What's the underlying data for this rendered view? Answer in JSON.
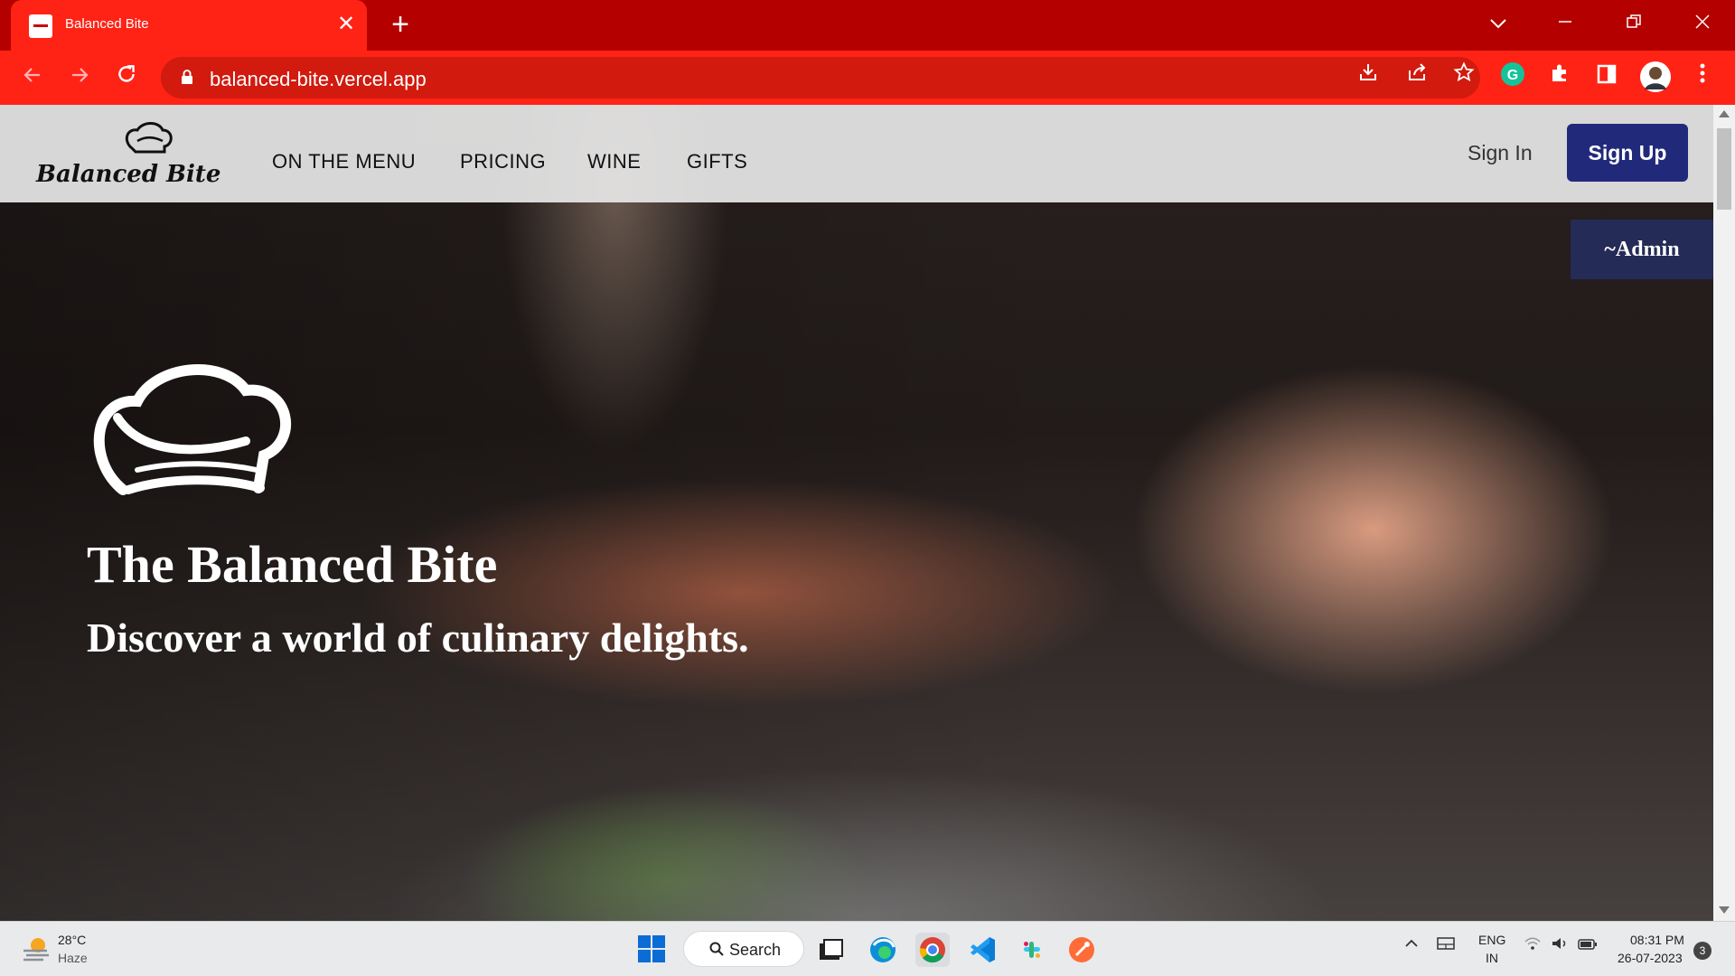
{
  "browser": {
    "tab_title": "Balanced Bite",
    "tab_close": "✕",
    "new_tab": "+",
    "url": "balanced-bite.vercel.app",
    "icons": [
      "back-icon",
      "forward-icon",
      "reload-icon",
      "lock-icon",
      "install-icon",
      "share-icon",
      "star-icon",
      "grammarly-icon",
      "extensions-icon",
      "sidepanel-icon",
      "profile-avatar",
      "menu-icon"
    ],
    "colors": {
      "tabstrip": "#b50000",
      "toolbar": "#ff2316"
    }
  },
  "site": {
    "logo_text": "Balanced Bite",
    "nav": [
      {
        "label": "ON THE MENU"
      },
      {
        "label": "PRICING"
      },
      {
        "label": "WINE"
      },
      {
        "label": "GIFTS"
      }
    ],
    "sign_in": "Sign In",
    "sign_up": "Sign Up",
    "admin_badge": "~Admin",
    "hero_title": "The Balanced Bite",
    "hero_subtitle": "Discover a world of culinary delights.",
    "colors": {
      "sign_up_bg": "#212a7a",
      "admin_bg": "#252b57"
    }
  },
  "taskbar": {
    "weather_temp": "28°C",
    "weather_condition": "Haze",
    "search_label": "Search",
    "apps": [
      "windows-start-icon",
      "file-explorer-icon",
      "edge-icon",
      "chrome-icon",
      "vscode-icon",
      "slack-icon",
      "postman-icon"
    ],
    "lang_top": "ENG",
    "lang_bottom": "IN",
    "time": "08:31 PM",
    "date": "26-07-2023",
    "notifications": "3"
  }
}
